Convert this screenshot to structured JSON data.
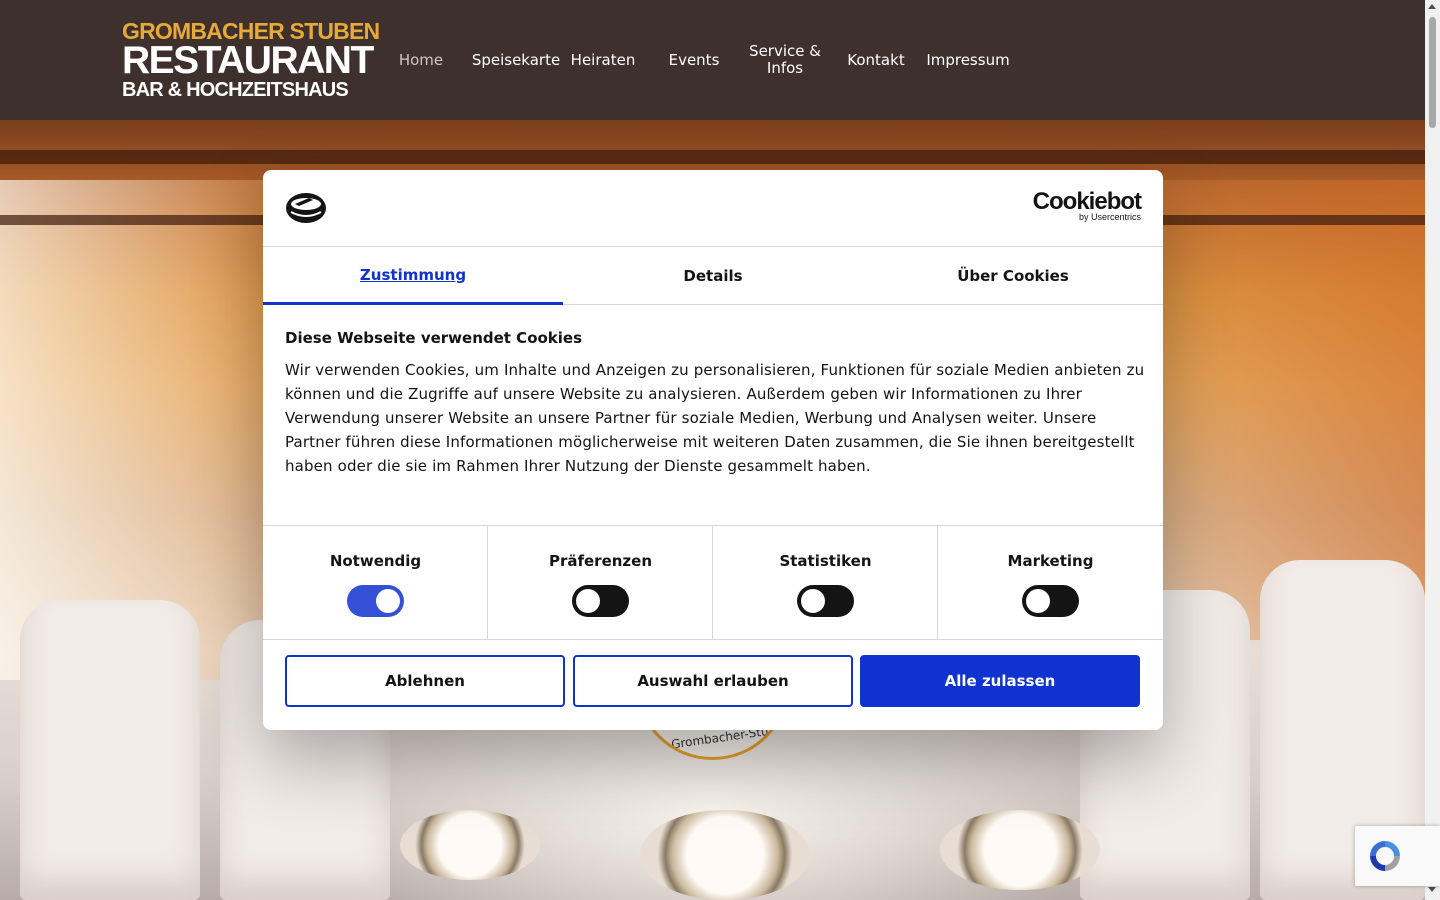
{
  "logo": {
    "line1": "GROMBACHER STUBEN",
    "line2": "RESTAURANT",
    "line3": "BAR & HOCHZEITSHAUS"
  },
  "nav": {
    "items": [
      {
        "label": "Home",
        "active": true
      },
      {
        "label": "Speisekarte"
      },
      {
        "label": "Heiraten"
      },
      {
        "label": "Events"
      },
      {
        "label": "Service & Infos"
      },
      {
        "label": "Kontakt"
      },
      {
        "label": "Impressum"
      }
    ]
  },
  "hero": {
    "badge_text": "-Grombacher-Stube"
  },
  "cookie_dialog": {
    "brand": "Cookiebot",
    "brand_sub": "by Usercentrics",
    "tabs": [
      {
        "label": "Zustimmung",
        "active": true
      },
      {
        "label": "Details"
      },
      {
        "label": "Über Cookies"
      }
    ],
    "title": "Diese Webseite verwendet Cookies",
    "text": "Wir verwenden Cookies, um Inhalte und Anzeigen zu personalisieren, Funktionen für soziale Medien anbieten zu können und die Zugriffe auf unsere Website zu analysieren. Außerdem geben wir Informationen zu Ihrer Verwendung unserer Website an unsere Partner für soziale Medien, Werbung und Analysen weiter. Unsere Partner führen diese Informationen möglicherweise mit weiteren Daten zusammen, die Sie ihnen bereitgestellt haben oder die sie im Rahmen Ihrer Nutzung der Dienste gesammelt haben.",
    "categories": [
      {
        "label": "Notwendig",
        "checked": true
      },
      {
        "label": "Präferenzen",
        "checked": false
      },
      {
        "label": "Statistiken",
        "checked": false
      },
      {
        "label": "Marketing",
        "checked": false
      }
    ],
    "buttons": {
      "decline": "Ablehnen",
      "allow_selection": "Auswahl erlauben",
      "allow_all": "Alle zulassen"
    }
  },
  "colors": {
    "header_bg": "#3e302c",
    "accent_blue": "#1032cf",
    "logo_gold": "#e7a93a"
  }
}
